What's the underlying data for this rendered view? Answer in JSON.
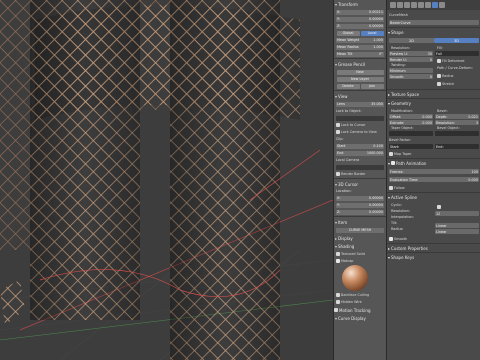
{
  "npanel": {
    "transform": {
      "title": "Transform",
      "x": "0.00211",
      "y": "0.00000",
      "z": "0.00000",
      "global": "Global",
      "local": "Local",
      "mean_weight": "Mean Weight",
      "mean_radius": "Mean Radius",
      "mean_tilt": "Mean Tilt",
      "mw_val": "1.000",
      "mr_val": "1.000",
      "mt_val": "0°"
    },
    "grease_pencil": {
      "title": "Grease Pencil",
      "new": "New",
      "new_layer": "New Layer",
      "delete": "Delete",
      "join": "Join"
    },
    "view": {
      "title": "View",
      "lens_label": "Lens",
      "lens": "35.000",
      "lock_to_object": "Lock to Object:",
      "lock_to_cursor": "Lock to Cursor",
      "lock_camera": "Lock Camera to View",
      "clip": "Clip:",
      "start_label": "Start",
      "start": "0.100",
      "end_label": "End",
      "end": "1000.000",
      "local_camera": "Local Camera",
      "render_border": "Render Border"
    },
    "cursor_3d": {
      "title": "3D Cursor",
      "location": "Location:",
      "x": "0.00000",
      "y": "0.00000",
      "z": "0.00000"
    },
    "item": {
      "title": "Item",
      "name": "CURVE MESH"
    },
    "display": {
      "title": "Display"
    },
    "shading": {
      "title": "Shading",
      "textured_solid": "Textured Solid",
      "matcap": "Matcap",
      "backface_culling": "Backface Culling",
      "hidden_wire": "Hidden Wire"
    },
    "motion_tracking": {
      "title": "Motion Tracking"
    },
    "curve_display": {
      "title": "Curve Display"
    }
  },
  "props": {
    "breadcrumb": "CurveMesh",
    "object_name": "BezierCurve",
    "shape": {
      "title": "Shape",
      "twod": "2D",
      "threed": "3D",
      "resolution_label": "Resolution:",
      "preview_u_label": "Preview U:",
      "preview_u": "30",
      "render_u_label": "Render U:",
      "render_u": "0",
      "fill_label": "Fill:",
      "fill_value": "Full",
      "fill_deform": "Fill Deformed",
      "twisting_label": "Twisting:",
      "twisting": "Minimum",
      "smooth_label": "Smooth:",
      "smooth": "0",
      "path_label": "Path / Curve-Deform:",
      "radius": "Radius",
      "stretch": "Stretch",
      "bounds_clamp": "Bounds Clamp"
    },
    "texture_space": {
      "title": "Texture Space"
    },
    "geometry": {
      "title": "Geometry",
      "modification": "Modification:",
      "offset_label": "Offset:",
      "offset": "0.000",
      "extrude_label": "Extrude:",
      "extrude": "0.000",
      "bevel_label": "Bevel:",
      "depth_label": "Depth:",
      "depth": "0.021",
      "resolution_label": "Resolution:",
      "resolution": "3",
      "fill_caps": "Fill Caps",
      "taper_object": "Taper Object:",
      "bevel_object": "Bevel Object:",
      "bevel_factor": "Bevel Factor:",
      "resolution_mode": "Resolution",
      "start": "Start:",
      "end": "End:",
      "map_taper": "Map Taper"
    },
    "path_animation": {
      "title": "Path Animation",
      "frames_label": "Frames:",
      "frames": "100",
      "eval_label": "Evaluation Time:",
      "eval": "0.000",
      "follow": "Follow",
      "clamp_label": "Clamp"
    },
    "active_spline": {
      "title": "Active Spline",
      "cyclic": "Cyclic:",
      "resolution_label": "Resolution:",
      "resolution": "12",
      "interpolation": "Interpolation:",
      "tilt_label": "Tilt:",
      "tilt": "Linear",
      "radius_label": "Radius:",
      "radius": "Linear",
      "smooth": "Smooth"
    },
    "custom_props": {
      "title": "Custom Properties"
    },
    "shape_keys": {
      "title": "Shape Keys"
    }
  }
}
